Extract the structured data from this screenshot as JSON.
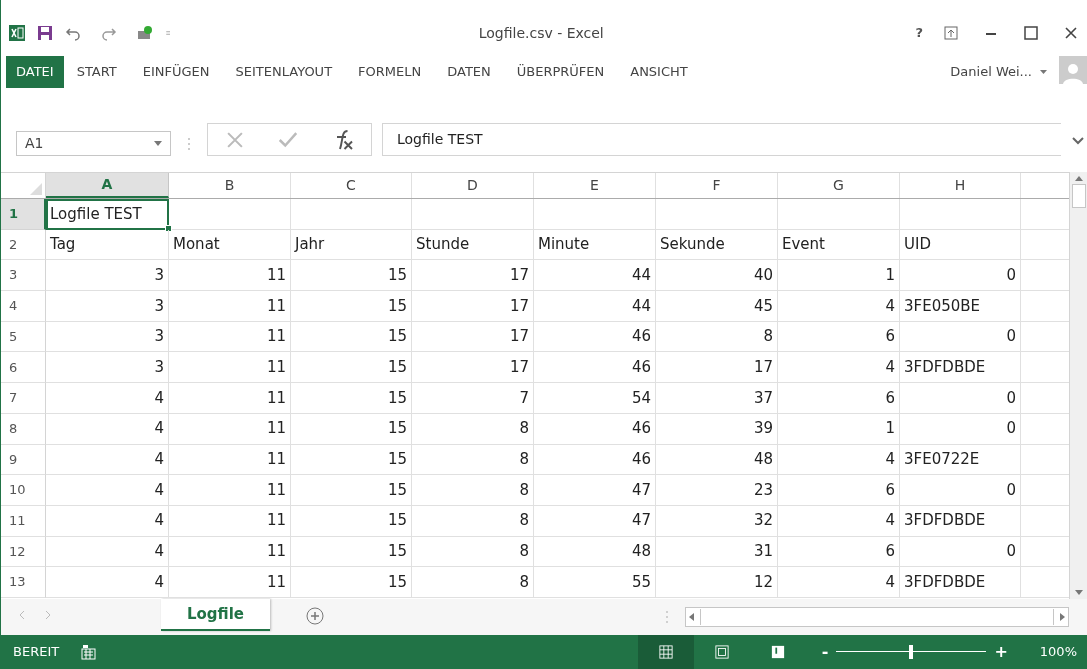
{
  "window": {
    "title": "Logfile.csv - Excel",
    "help": "?"
  },
  "ribbon_tabs": [
    {
      "label": "DATEI",
      "kind": "file"
    },
    {
      "label": "START",
      "kind": "tab"
    },
    {
      "label": "EINFÜGEN",
      "kind": "tab"
    },
    {
      "label": "SEITENLAYOUT",
      "kind": "tab"
    },
    {
      "label": "FORMELN",
      "kind": "tab"
    },
    {
      "label": "DATEN",
      "kind": "tab"
    },
    {
      "label": "ÜBERPRÜFEN",
      "kind": "tab"
    },
    {
      "label": "ANSICHT",
      "kind": "tab"
    }
  ],
  "user": {
    "name": "Daniel Wei..."
  },
  "formula_bar": {
    "name_box": "A1",
    "value": "Logfile TEST"
  },
  "columns": [
    {
      "label": "A",
      "selected": true
    },
    {
      "label": "B",
      "selected": false
    },
    {
      "label": "C",
      "selected": false
    },
    {
      "label": "D",
      "selected": false
    },
    {
      "label": "E",
      "selected": false
    },
    {
      "label": "F",
      "selected": false
    },
    {
      "label": "G",
      "selected": false
    },
    {
      "label": "H",
      "selected": false
    }
  ],
  "rows": [
    {
      "number": "1",
      "selected": true,
      "cells": [
        {
          "v": "Logfile TEST",
          "kind": "text"
        }
      ]
    },
    {
      "number": "2",
      "selected": false,
      "cells": [
        {
          "v": "Tag",
          "kind": "text"
        },
        {
          "v": "Monat",
          "kind": "text"
        },
        {
          "v": "Jahr",
          "kind": "text"
        },
        {
          "v": "Stunde",
          "kind": "text"
        },
        {
          "v": "Minute",
          "kind": "text"
        },
        {
          "v": "Sekunde",
          "kind": "text"
        },
        {
          "v": "Event",
          "kind": "text"
        },
        {
          "v": "UID",
          "kind": "text"
        }
      ]
    },
    {
      "number": "3",
      "selected": false,
      "cells": [
        {
          "v": "3",
          "kind": "number"
        },
        {
          "v": "11",
          "kind": "number"
        },
        {
          "v": "15",
          "kind": "number"
        },
        {
          "v": "17",
          "kind": "number"
        },
        {
          "v": "44",
          "kind": "number"
        },
        {
          "v": "40",
          "kind": "number"
        },
        {
          "v": "1",
          "kind": "number"
        },
        {
          "v": "0",
          "kind": "number"
        }
      ]
    },
    {
      "number": "4",
      "selected": false,
      "cells": [
        {
          "v": "3",
          "kind": "number"
        },
        {
          "v": "11",
          "kind": "number"
        },
        {
          "v": "15",
          "kind": "number"
        },
        {
          "v": "17",
          "kind": "number"
        },
        {
          "v": "44",
          "kind": "number"
        },
        {
          "v": "45",
          "kind": "number"
        },
        {
          "v": "4",
          "kind": "number"
        },
        {
          "v": "3FE050BE",
          "kind": "text"
        }
      ]
    },
    {
      "number": "5",
      "selected": false,
      "cells": [
        {
          "v": "3",
          "kind": "number"
        },
        {
          "v": "11",
          "kind": "number"
        },
        {
          "v": "15",
          "kind": "number"
        },
        {
          "v": "17",
          "kind": "number"
        },
        {
          "v": "46",
          "kind": "number"
        },
        {
          "v": "8",
          "kind": "number"
        },
        {
          "v": "6",
          "kind": "number"
        },
        {
          "v": "0",
          "kind": "number"
        }
      ]
    },
    {
      "number": "6",
      "selected": false,
      "cells": [
        {
          "v": "3",
          "kind": "number"
        },
        {
          "v": "11",
          "kind": "number"
        },
        {
          "v": "15",
          "kind": "number"
        },
        {
          "v": "17",
          "kind": "number"
        },
        {
          "v": "46",
          "kind": "number"
        },
        {
          "v": "17",
          "kind": "number"
        },
        {
          "v": "4",
          "kind": "number"
        },
        {
          "v": "3FDFDBDE",
          "kind": "text"
        }
      ]
    },
    {
      "number": "7",
      "selected": false,
      "cells": [
        {
          "v": "4",
          "kind": "number"
        },
        {
          "v": "11",
          "kind": "number"
        },
        {
          "v": "15",
          "kind": "number"
        },
        {
          "v": "7",
          "kind": "number"
        },
        {
          "v": "54",
          "kind": "number"
        },
        {
          "v": "37",
          "kind": "number"
        },
        {
          "v": "6",
          "kind": "number"
        },
        {
          "v": "0",
          "kind": "number"
        }
      ]
    },
    {
      "number": "8",
      "selected": false,
      "cells": [
        {
          "v": "4",
          "kind": "number"
        },
        {
          "v": "11",
          "kind": "number"
        },
        {
          "v": "15",
          "kind": "number"
        },
        {
          "v": "8",
          "kind": "number"
        },
        {
          "v": "46",
          "kind": "number"
        },
        {
          "v": "39",
          "kind": "number"
        },
        {
          "v": "1",
          "kind": "number"
        },
        {
          "v": "0",
          "kind": "number"
        }
      ]
    },
    {
      "number": "9",
      "selected": false,
      "cells": [
        {
          "v": "4",
          "kind": "number"
        },
        {
          "v": "11",
          "kind": "number"
        },
        {
          "v": "15",
          "kind": "number"
        },
        {
          "v": "8",
          "kind": "number"
        },
        {
          "v": "46",
          "kind": "number"
        },
        {
          "v": "48",
          "kind": "number"
        },
        {
          "v": "4",
          "kind": "number"
        },
        {
          "v": "3FE0722E",
          "kind": "text"
        }
      ]
    },
    {
      "number": "10",
      "selected": false,
      "cells": [
        {
          "v": "4",
          "kind": "number"
        },
        {
          "v": "11",
          "kind": "number"
        },
        {
          "v": "15",
          "kind": "number"
        },
        {
          "v": "8",
          "kind": "number"
        },
        {
          "v": "47",
          "kind": "number"
        },
        {
          "v": "23",
          "kind": "number"
        },
        {
          "v": "6",
          "kind": "number"
        },
        {
          "v": "0",
          "kind": "number"
        }
      ]
    },
    {
      "number": "11",
      "selected": false,
      "cells": [
        {
          "v": "4",
          "kind": "number"
        },
        {
          "v": "11",
          "kind": "number"
        },
        {
          "v": "15",
          "kind": "number"
        },
        {
          "v": "8",
          "kind": "number"
        },
        {
          "v": "47",
          "kind": "number"
        },
        {
          "v": "32",
          "kind": "number"
        },
        {
          "v": "4",
          "kind": "number"
        },
        {
          "v": "3FDFDBDE",
          "kind": "text"
        }
      ]
    },
    {
      "number": "12",
      "selected": false,
      "cells": [
        {
          "v": "4",
          "kind": "number"
        },
        {
          "v": "11",
          "kind": "number"
        },
        {
          "v": "15",
          "kind": "number"
        },
        {
          "v": "8",
          "kind": "number"
        },
        {
          "v": "48",
          "kind": "number"
        },
        {
          "v": "31",
          "kind": "number"
        },
        {
          "v": "6",
          "kind": "number"
        },
        {
          "v": "0",
          "kind": "number"
        }
      ]
    },
    {
      "number": "13",
      "selected": false,
      "cells": [
        {
          "v": "4",
          "kind": "number"
        },
        {
          "v": "11",
          "kind": "number"
        },
        {
          "v": "15",
          "kind": "number"
        },
        {
          "v": "8",
          "kind": "number"
        },
        {
          "v": "55",
          "kind": "number"
        },
        {
          "v": "12",
          "kind": "number"
        },
        {
          "v": "4",
          "kind": "number"
        },
        {
          "v": "3FDFDBDE",
          "kind": "text"
        }
      ]
    }
  ],
  "sheet_tabs": [
    {
      "label": "Logfile",
      "selected": true
    }
  ],
  "status_bar": {
    "status": "BEREIT",
    "views": [
      {
        "kind": "normal",
        "selected": true
      },
      {
        "kind": "layout",
        "selected": false
      },
      {
        "kind": "pagebreak",
        "selected": false
      }
    ],
    "zoom": {
      "minus": "-",
      "plus": "+",
      "level": 0.5,
      "reading": "100%"
    }
  }
}
